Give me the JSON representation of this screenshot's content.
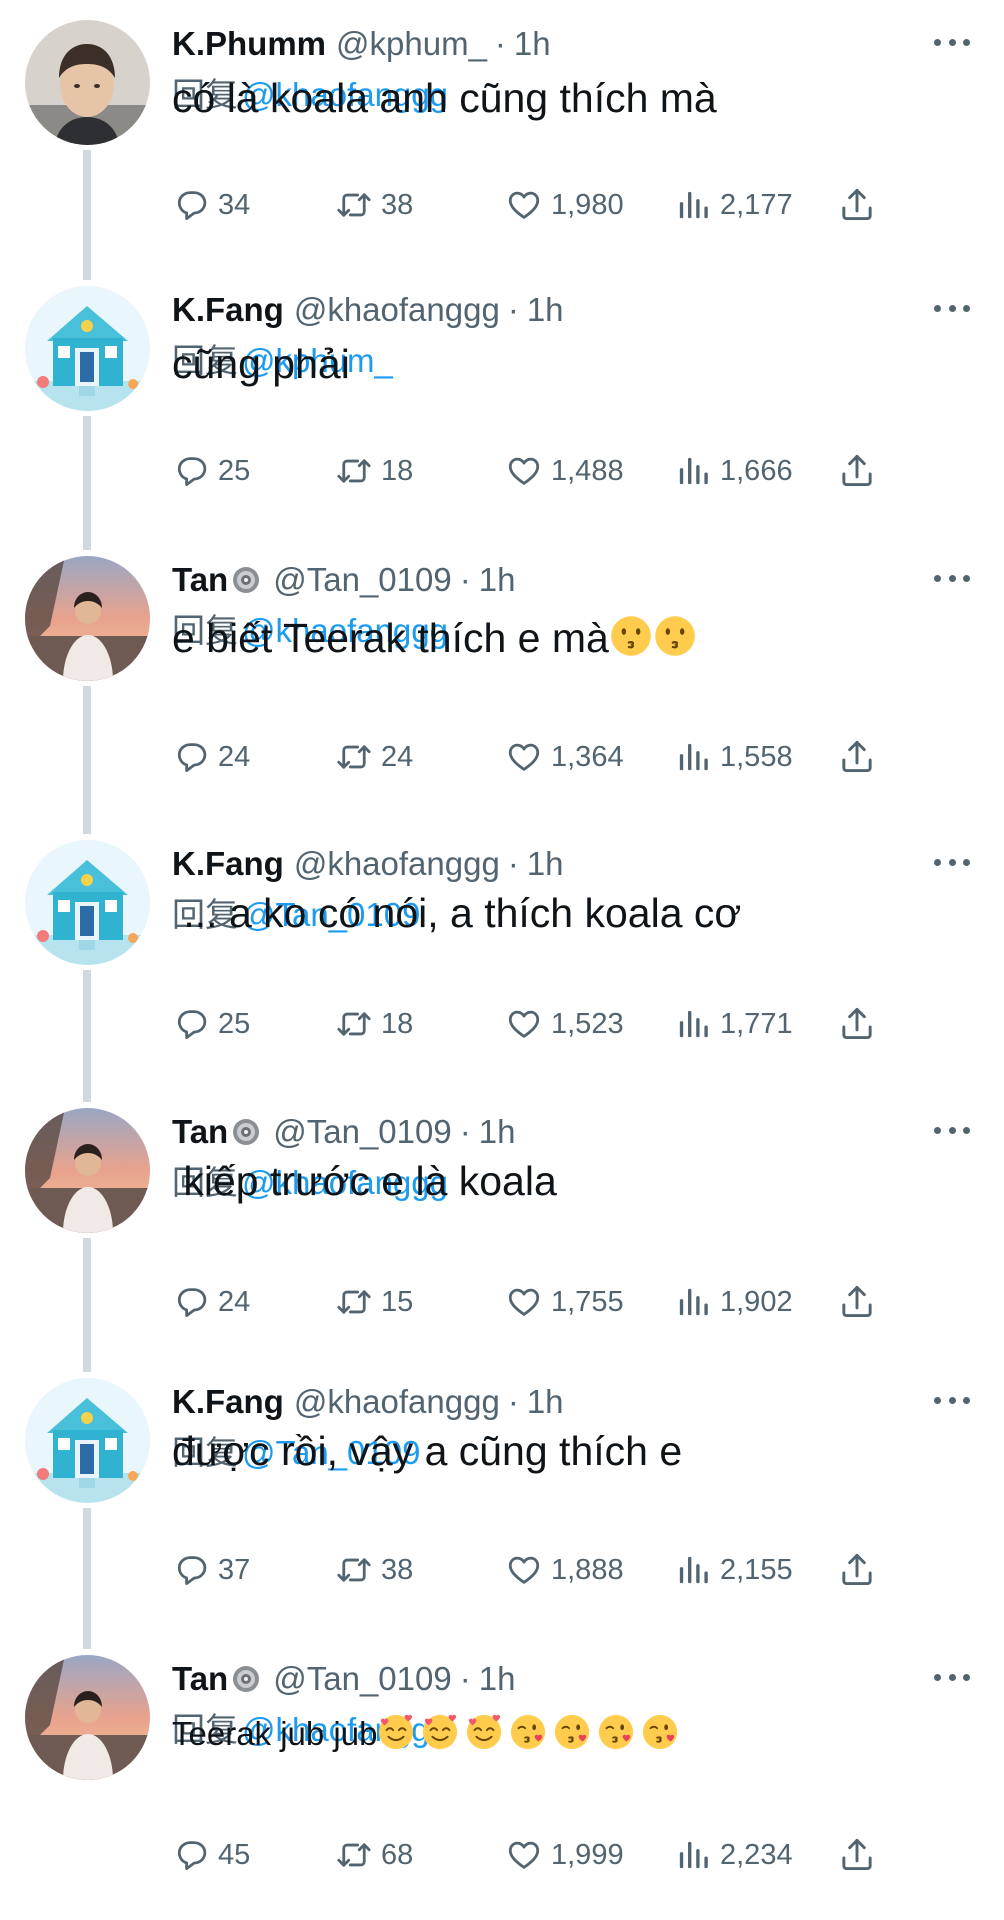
{
  "reply_prefix": "回复",
  "time_separator": "·",
  "colors": {
    "link": "#1d9bf0",
    "muted": "#536471",
    "text": "#0f1419",
    "thread_line": "#cfd9de"
  },
  "tweets": [
    {
      "name": "K.Phumm",
      "verified": false,
      "handle": "@kphum_",
      "time": "1h",
      "reply_to": "@khaofanggg",
      "text": "có là koala anh cũng thích mà",
      "emojis": [],
      "stats": {
        "replies": "34",
        "retweets": "38",
        "likes": "1,980",
        "views": "2,177"
      },
      "avatar": "portrait-photo"
    },
    {
      "name": "K.Fang",
      "verified": false,
      "handle": "@khaofanggg",
      "time": "1h",
      "reply_to": "@kphum_",
      "text": "cũng phải",
      "emojis": [],
      "stats": {
        "replies": "25",
        "retweets": "18",
        "likes": "1,488",
        "views": "1,666"
      },
      "avatar": "blue-house-illustration"
    },
    {
      "name": "Tan",
      "verified": true,
      "handle": "@Tan_0109",
      "time": "1h",
      "reply_to": "@khaofanggg",
      "text": "e biết Teerak thích e mà",
      "emojis": [
        "kissing-face",
        "kissing-face"
      ],
      "stats": {
        "replies": "24",
        "retweets": "24",
        "likes": "1,364",
        "views": "1,558"
      },
      "avatar": "sunset-portrait-photo"
    },
    {
      "name": "K.Fang",
      "verified": false,
      "handle": "@khaofanggg",
      "time": "1h",
      "reply_to": "@Tan_0109",
      "text": " ... a ko có nói, a thích koala cơ",
      "emojis": [],
      "stats": {
        "replies": "25",
        "retweets": "18",
        "likes": "1,523",
        "views": "1,771"
      },
      "avatar": "blue-house-illustration"
    },
    {
      "name": "Tan",
      "verified": true,
      "handle": "@Tan_0109",
      "time": "1h",
      "reply_to": "@khaofanggg",
      "text": " kiếp trước e là koala",
      "emojis": [],
      "stats": {
        "replies": "24",
        "retweets": "15",
        "likes": "1,755",
        "views": "1,902"
      },
      "avatar": "sunset-portrait-photo"
    },
    {
      "name": "K.Fang",
      "verified": false,
      "handle": "@khaofanggg",
      "time": "1h",
      "reply_to": "@Tan_0109",
      "text": "được rồi, vậy a cũng thích e",
      "emojis": [],
      "stats": {
        "replies": "37",
        "retweets": "38",
        "likes": "1,888",
        "views": "2,155"
      },
      "avatar": "blue-house-illustration"
    },
    {
      "name": "Tan",
      "verified": true,
      "handle": "@Tan_0109",
      "time": "1h",
      "reply_to": "@khaofanggg",
      "text": "Teerak jub jub",
      "emojis": [
        "smiling-face-with-hearts",
        "smiling-face-with-hearts",
        "smiling-face-with-hearts",
        "face-blowing-kiss",
        "face-blowing-kiss",
        "face-blowing-kiss",
        "face-blowing-kiss"
      ],
      "stats": {
        "replies": "45",
        "retweets": "68",
        "likes": "1,999",
        "views": "2,234"
      },
      "avatar": "sunset-portrait-photo"
    }
  ]
}
